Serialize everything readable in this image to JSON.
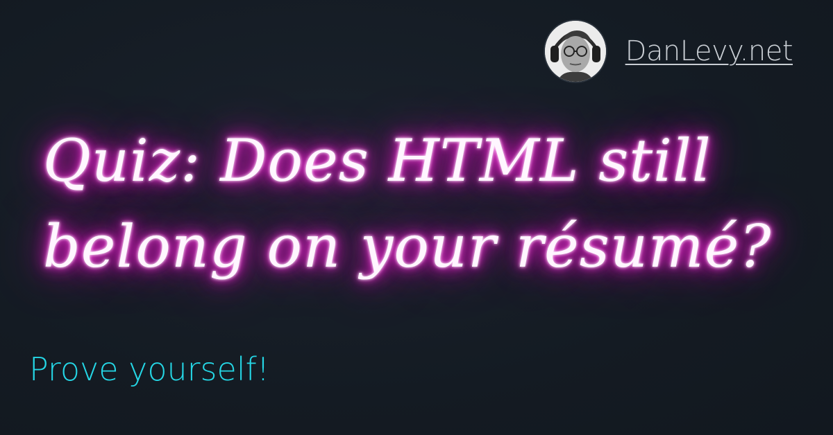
{
  "author": {
    "site": "DanLevy.net",
    "avatar_icon": "person-portrait-icon"
  },
  "headline": {
    "line1": "Quiz: Does HTML still",
    "line2": "belong on your résumé?"
  },
  "tagline": "Prove yourself!",
  "colors": {
    "background": "#141b23",
    "neon_glow": "#f01ad2",
    "tagline": "#25d7e6",
    "link": "#c9ced4"
  }
}
